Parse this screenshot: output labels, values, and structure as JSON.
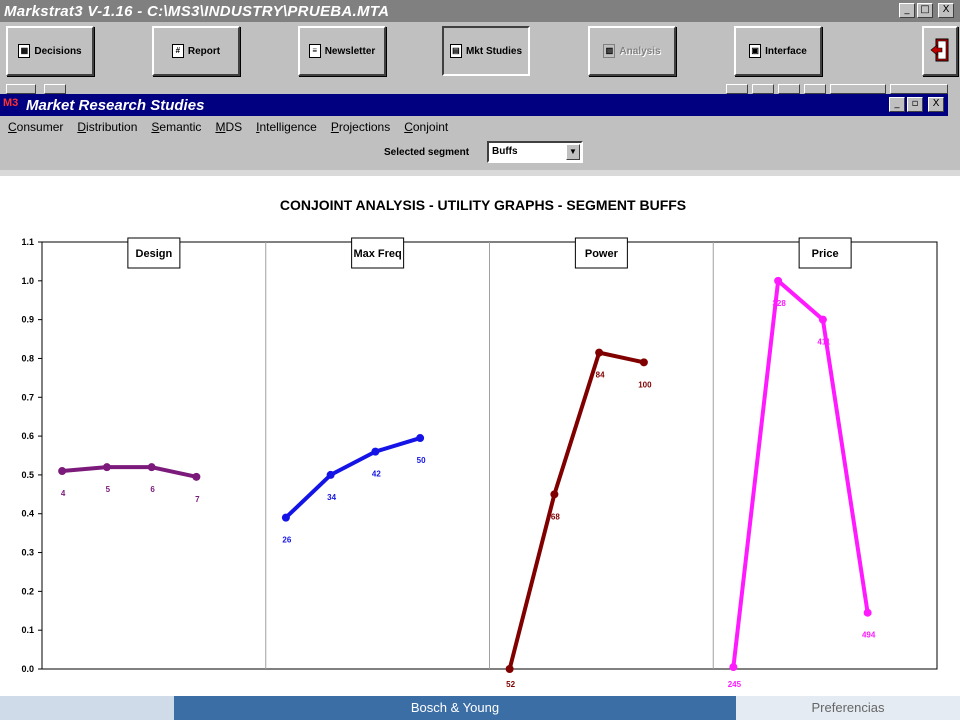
{
  "window": {
    "title": "Markstrat3 V-1.16 - C:\\MS3\\INDUSTRY\\PRUEBA.MTA",
    "controls": [
      "_",
      "□",
      "X"
    ]
  },
  "toolbar": {
    "buttons": [
      {
        "label": "Decisions",
        "icon": "calculator-icon",
        "enabled": true
      },
      {
        "label": "Report",
        "icon": "report-icon",
        "enabled": true
      },
      {
        "label": "Newsletter",
        "icon": "newsletter-icon",
        "enabled": true
      },
      {
        "label": "Mkt Studies",
        "icon": "studies-icon",
        "enabled": true
      },
      {
        "label": "Analysis",
        "icon": "analysis-icon",
        "enabled": false
      },
      {
        "label": "Interface",
        "icon": "interface-icon",
        "enabled": true
      }
    ],
    "exit_icon": "exit-door-icon"
  },
  "study_window": {
    "title": "Market Research Studies",
    "logo_text": "M3",
    "controls": [
      "_",
      "▫",
      "X"
    ],
    "menu": [
      "Consumer",
      "Distribution",
      "Semantic",
      "MDS",
      "Intelligence",
      "Projections",
      "Conjoint"
    ],
    "segment": {
      "label": "Selected segment",
      "value": "Buffs"
    }
  },
  "chart_data": {
    "type": "line",
    "title": "CONJOINT ANALYSIS - UTILITY GRAPHS - SEGMENT BUFFS",
    "ylim": [
      0,
      1.1
    ],
    "y_ticks": [
      "0.0",
      "0.1",
      "0.2",
      "0.3",
      "0.4",
      "0.5",
      "0.6",
      "0.7",
      "0.8",
      "0.9",
      "1.0",
      "1.1"
    ],
    "grid": true,
    "panels": [
      {
        "name": "Design",
        "color": "#7b1a7b",
        "points": [
          {
            "label": "4",
            "y": 0.51
          },
          {
            "label": "5",
            "y": 0.52
          },
          {
            "label": "6",
            "y": 0.52
          },
          {
            "label": "7",
            "y": 0.495
          }
        ]
      },
      {
        "name": "Max Freq",
        "color": "#1414e6",
        "points": [
          {
            "label": "26",
            "y": 0.39
          },
          {
            "label": "34",
            "y": 0.5
          },
          {
            "label": "42",
            "y": 0.56
          },
          {
            "label": "50",
            "y": 0.595
          }
        ]
      },
      {
        "name": "Power",
        "color": "#800000",
        "points": [
          {
            "label": "52",
            "y": 0.0
          },
          {
            "label": "68",
            "y": 0.45
          },
          {
            "label": "84",
            "y": 0.815
          },
          {
            "label": "100",
            "y": 0.79
          }
        ]
      },
      {
        "name": "Price",
        "color": "#ff1aff",
        "points": [
          {
            "label": "245",
            "y": 0.005
          },
          {
            "label": "328",
            "y": 1.0
          },
          {
            "label": "411",
            "y": 0.9
          },
          {
            "label": "494",
            "y": 0.145
          }
        ]
      }
    ]
  },
  "footer": {
    "center": "Bosch & Young",
    "right": "Preferencias"
  }
}
